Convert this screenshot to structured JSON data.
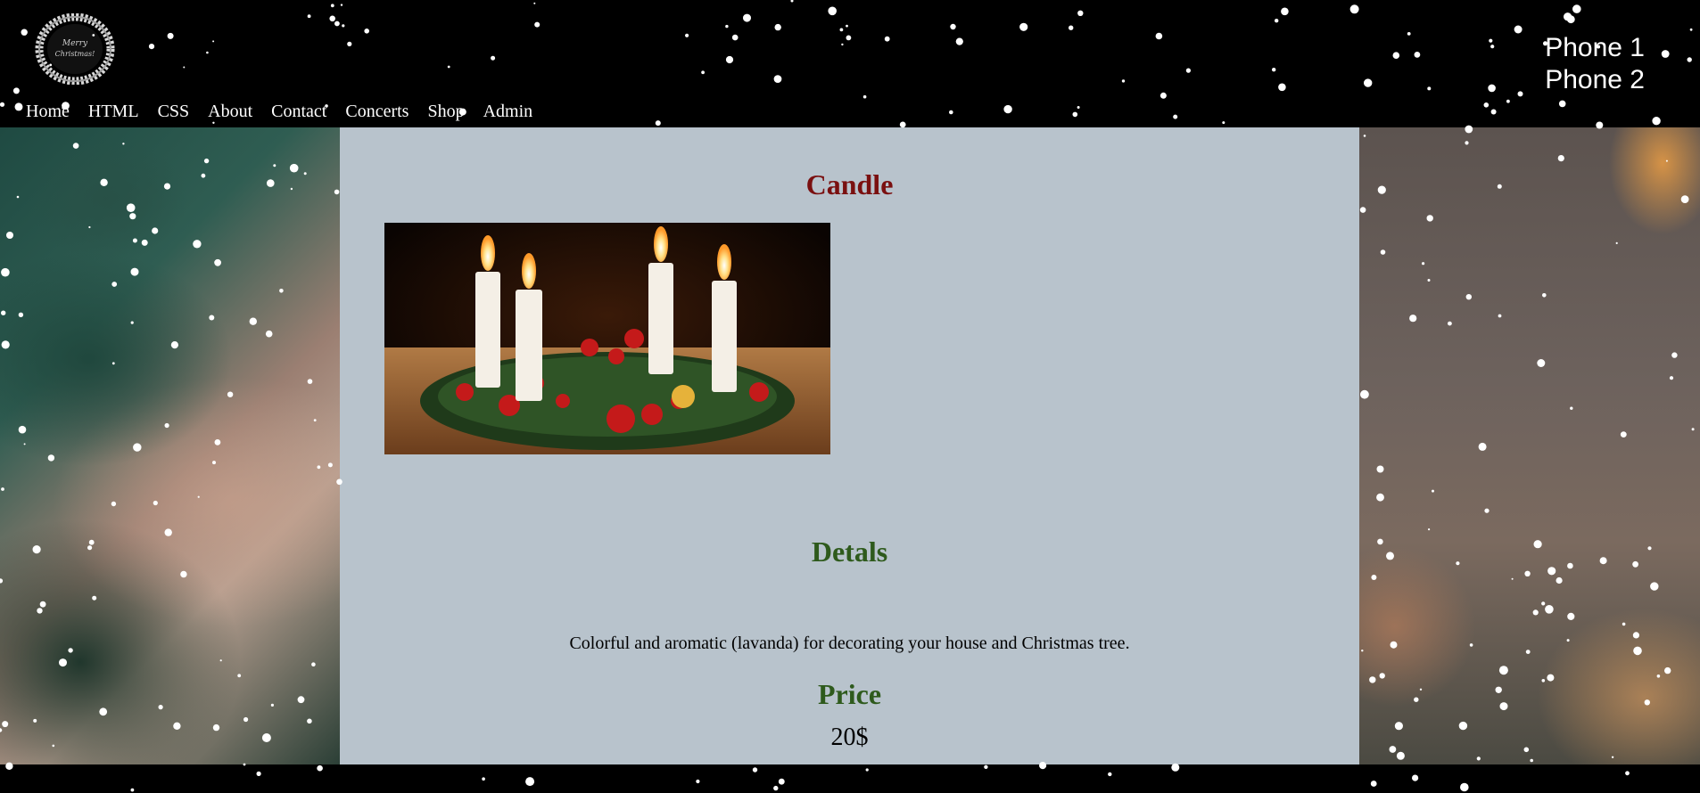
{
  "header": {
    "logo_name": "merry-christmas-wreath-logo",
    "logo_text": "Merry Christmas",
    "phones": [
      "Phone 1",
      "Phone 2"
    ]
  },
  "nav": {
    "items": [
      "Home",
      "HTML",
      "CSS",
      "About",
      "Contact",
      "Concerts",
      "Shop",
      "Admin"
    ]
  },
  "product": {
    "title": "Candle",
    "image_icon": "advent-candles-image",
    "details_heading": "Detals",
    "details_text": "Colorful and aromatic (lavanda) for decorating your house and Christmas tree.",
    "price_heading": "Price",
    "price_value": "20$"
  },
  "colors": {
    "title": "#7a1010",
    "section_heading": "#2e5a1c",
    "content_bg": "#b8c3cc",
    "page_bg": "#000000"
  }
}
